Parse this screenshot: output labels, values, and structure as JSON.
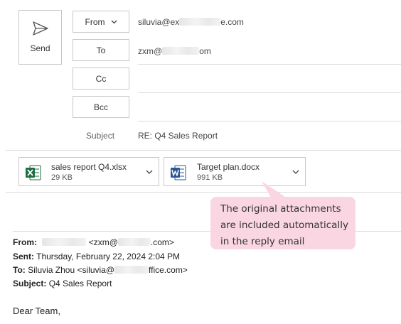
{
  "compose": {
    "send_label": "Send",
    "from_label": "From",
    "from_value_prefix": "siluvia@ex",
    "from_value_suffix": "e.com",
    "to_label": "To",
    "to_value_prefix": "zxm@",
    "to_value_suffix": "om",
    "cc_label": "Cc",
    "bcc_label": "Bcc",
    "subject_label": "Subject",
    "subject_value": "RE: Q4 Sales Report"
  },
  "attachments": [
    {
      "name": "sales report Q4.xlsx",
      "size": "29 KB",
      "icon": "excel-file-icon",
      "color": "#1d6f42"
    },
    {
      "name": "Target plan.docx",
      "size": "991 KB",
      "icon": "word-file-icon",
      "color": "#2b5797"
    }
  ],
  "callout": {
    "line1": "The original attachments",
    "line2": "are included automatically",
    "line3": "in the reply email"
  },
  "quoted": {
    "from_label": "From:",
    "from_value_prefix": "<zxm@",
    "from_value_suffix": ".com>",
    "sent_label": "Sent:",
    "sent_value": "Thursday, February 22, 2024 2:04 PM",
    "to_label": "To:",
    "to_value_prefix": "Siluvia Zhou <siluvia@",
    "to_value_suffix": "ffice.com>",
    "subject_label": "Subject:",
    "subject_value": "Q4 Sales Report",
    "greeting": "Dear Team,"
  },
  "colors": {
    "callout_bg": "#f9d6e1",
    "excel_green": "#1d6f42",
    "word_blue": "#2b5797"
  }
}
